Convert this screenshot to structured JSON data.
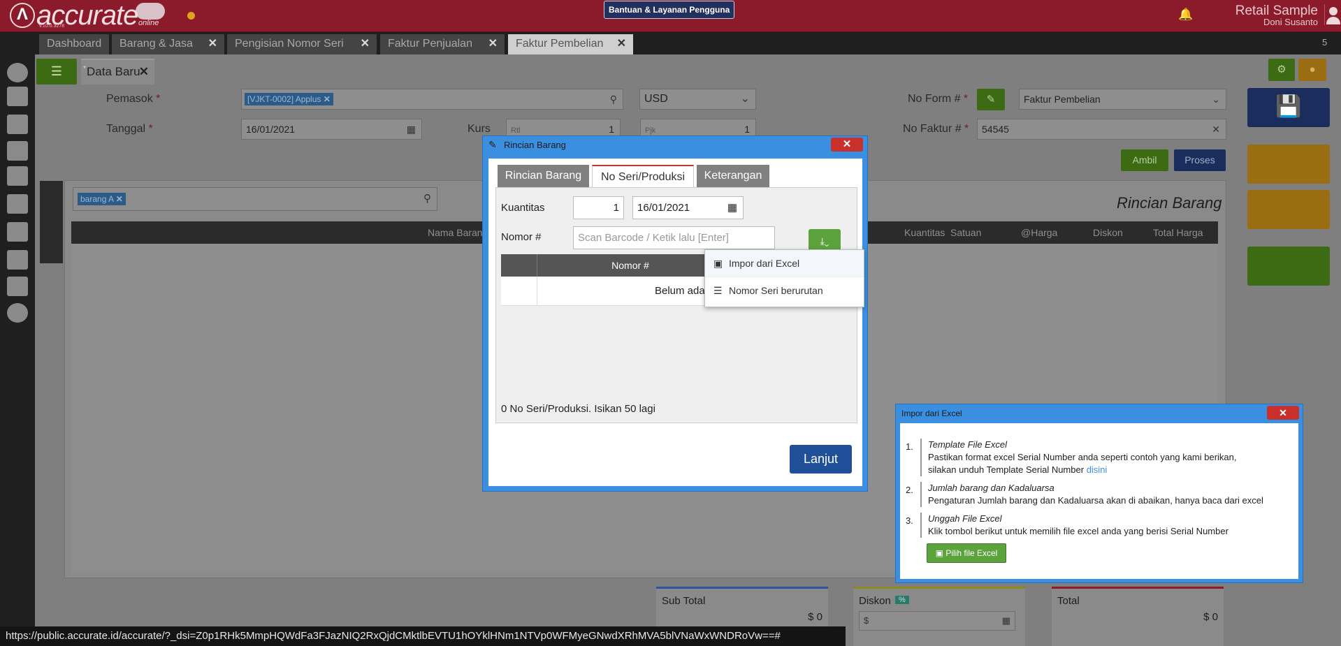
{
  "app": {
    "logo_text": "accurate",
    "logo_sub": "online",
    "version": "v.10.0.3278",
    "help_button": "Bantuan & Layanan Pengguna",
    "company": "Retail Sample",
    "user": "Doni Susanto",
    "tab_count": "5"
  },
  "tabs": [
    {
      "label": "Dashboard"
    },
    {
      "label": "Barang & Jasa"
    },
    {
      "label": "Pengisian Nomor Seri"
    },
    {
      "label": "Faktur Penjualan"
    },
    {
      "label": "Faktur Pembelian"
    }
  ],
  "doc_tab": {
    "label": "Data Baru"
  },
  "form": {
    "pemasok_label": "Pemasok",
    "pemasok_value": "[VJKT-0002] Applus",
    "currency": "USD",
    "tanggal_label": "Tanggal",
    "tanggal_value": "16/01/2021",
    "kurs_label": "Kurs",
    "kurs_rate_placeholder": "Rtl",
    "kurs_rate": "1",
    "kurs_pajak_placeholder": "Pjk",
    "kurs_pajak": "1",
    "noform_label": "No Form #",
    "noform_value": "Faktur Pembelian",
    "nofaktur_label": "No Faktur #",
    "nofaktur_value": "54545",
    "ambil": "Ambil",
    "proses": "Proses"
  },
  "detail": {
    "title": "Rincian Barang",
    "search_chip": "barang A",
    "columns": [
      "Nama Barang",
      "Kuantitas",
      "Satuan",
      "@Harga",
      "Diskon",
      "Total Harga"
    ]
  },
  "summary": {
    "subtotal_label": "Sub Total",
    "subtotal_value": "$ 0",
    "diskon_label": "Diskon",
    "diskon_badge": "%",
    "diskon_placeholder": "$",
    "total_label": "Total",
    "total_value": "$ 0"
  },
  "status_url": "https://public.accurate.id/accurate/?_dsi=Z0p1RHk5MmpHQWdFa3FJazNIQ2RxQjdCMktlbEVTU1hOYklHNm1NTVp0WFMyeGNwdXRhMVA5blVNaWxWNDRoVw==#",
  "dialog_rincian": {
    "title": "Rincian Barang",
    "tabs": [
      "Rincian Barang",
      "No Seri/Produksi",
      "Keterangan"
    ],
    "active_tab": "No Seri/Produksi",
    "kuantitas_label": "Kuantitas",
    "kuantitas_value": "1",
    "date_value": "16/01/2021",
    "nomor_label": "Nomor #",
    "nomor_placeholder": "Scan Barcode / Ketik lalu [Enter]",
    "grid_header": "Nomor #",
    "empty_text": "Belum ada",
    "count_text": "0 No Seri/Produksi. Isikan 50 lagi",
    "lanjut": "Lanjut",
    "menu": [
      "Impor dari Excel",
      "Nomor Seri berurutan"
    ]
  },
  "dialog_impor": {
    "title": "Impor dari Excel",
    "steps": [
      {
        "num": "1.",
        "title": "Template File Excel",
        "line1": "Pastikan format excel Serial Number anda seperti contoh yang kami berikan,",
        "line2": "silakan unduh Template Serial Number",
        "link": "disini"
      },
      {
        "num": "2.",
        "title": "Jumlah barang dan Kadaluarsa",
        "line1": "Pengaturan Jumlah barang dan Kadaluarsa akan di abaikan, hanya baca dari excel"
      },
      {
        "num": "3.",
        "title": "Unggah File Excel",
        "line1": "Klik tombol berikut untuk memilih file excel anda yang berisi Serial Number"
      }
    ],
    "button": "Pilih file Excel"
  }
}
